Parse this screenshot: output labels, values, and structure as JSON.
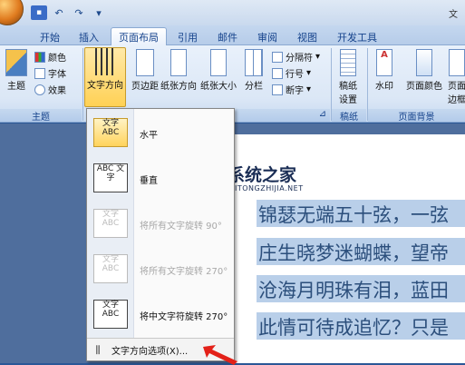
{
  "title_bar": {
    "right_text": "文"
  },
  "tabs": [
    "开始",
    "插入",
    "页面布局",
    "引用",
    "邮件",
    "审阅",
    "视图",
    "开发工具"
  ],
  "active_tab": "页面布局",
  "ribbon": {
    "theme_group": {
      "label": "主题",
      "big_button": "主题",
      "small_buttons": [
        "颜色",
        "字体",
        "效果"
      ]
    },
    "page_setup_group": {
      "buttons": [
        "文字方向",
        "页边距",
        "纸张方向",
        "纸张大小",
        "分栏"
      ],
      "small_buttons": [
        "分隔符",
        "行号",
        "断字"
      ]
    },
    "draft_group": {
      "label": "稿纸",
      "button": "稿纸设置"
    },
    "page_bg_group": {
      "label": "页面背景",
      "buttons": [
        "水印",
        "页面颜色",
        "页面边框"
      ]
    }
  },
  "text_direction_menu": {
    "items": [
      {
        "icon_text": "文字 ABC",
        "label": "水平",
        "state": "selected"
      },
      {
        "icon_text": "ABC 文字",
        "label": "垂直",
        "state": "normal"
      },
      {
        "icon_text": "文字 ABC",
        "label": "将所有文字旋转 90°",
        "state": "disabled"
      },
      {
        "icon_text": "文字 ABC",
        "label": "将所有文字旋转 270°",
        "state": "disabled"
      },
      {
        "icon_text": "文字 ABC",
        "label": "将中文字符旋转 270°",
        "state": "normal"
      }
    ],
    "footer_label": "文字方向选项(X)..."
  },
  "document": {
    "lines": [
      "锦瑟无端五十弦，一弦",
      "庄生晓梦迷蝴蝶，望帝",
      "沧海月明珠有泪，蓝田",
      "此情可待成追忆？只是"
    ]
  },
  "watermark": {
    "name": "系统之家",
    "domain": "XITONGZHIJIA.NET"
  },
  "colors": {
    "ribbon": "#dbe7f6",
    "highlight": "#ffd155",
    "selection": "#b9cfe9",
    "doc_bg": "#4f6e9d"
  }
}
